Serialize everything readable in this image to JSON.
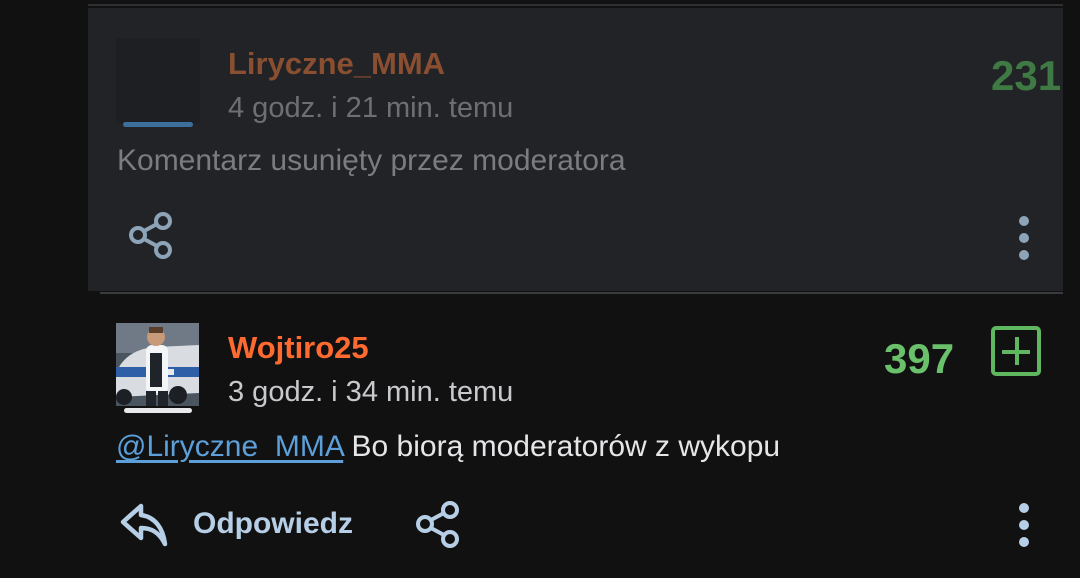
{
  "comments": [
    {
      "username": "Liryczne_MMA",
      "time": "4 godz. i 21 min. temu",
      "score": "231",
      "text": "Komentarz usunięty przez moderatora",
      "actions": {
        "share_icon": "share-icon",
        "more_icon": "more-vertical-icon"
      }
    },
    {
      "username": "Wojtiro25",
      "time": "3 godz. i 34 min. temu",
      "score": "397",
      "mention": "@Liryczne_MMA",
      "text": "Bo biorą moderatorów z wykopu",
      "actions": {
        "reply_label": "Odpowiedz",
        "reply_icon": "reply-icon",
        "share_icon": "share-icon",
        "more_icon": "more-vertical-icon",
        "upvote_icon": "plus-box-icon"
      }
    }
  ],
  "colors": {
    "background": "#111112",
    "removed_block": "#222326",
    "removed_username": "#8a4f30",
    "removed_text": "#7b7c80",
    "removed_score": "#3f7a45",
    "username": "#ff6a30",
    "time": "#c8c9cc",
    "score": "#6ac06b",
    "comment_text": "#e6e6e8",
    "mention": "#5d9fd8",
    "icon": "#b7cfe6",
    "removed_icon": "#8da4b8"
  }
}
